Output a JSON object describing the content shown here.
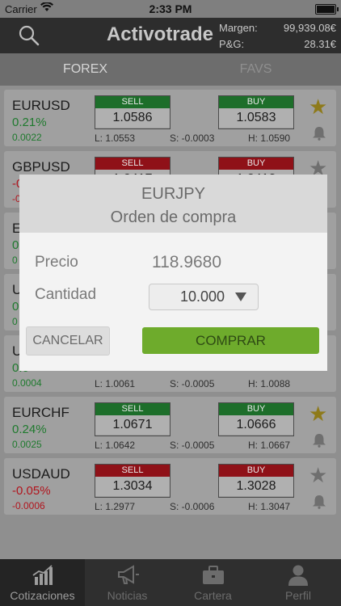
{
  "status": {
    "carrier": "Carrier",
    "time": "2:33 PM"
  },
  "header": {
    "title": "Activotrade",
    "margin_label": "Margen:",
    "margin_value": "99,939.08€",
    "pl_label": "P&G:",
    "pl_value": "28.31€"
  },
  "segments": {
    "forex": "FOREX",
    "favs": "FAVS"
  },
  "quotes": [
    {
      "symbol": "EURUSD",
      "pct": "0.21%",
      "chg": "0.0022",
      "sell_label": "SELL",
      "sell": "1.0586",
      "buy_label": "BUY",
      "buy": "1.0583",
      "low": "L: 1.0553",
      "spread": "S: -0.0003",
      "high": "H: 1.0590"
    },
    {
      "symbol": "GBPUSD",
      "pct": "-0",
      "chg": "-0",
      "sell_label": "SELL",
      "sell": "1.2417",
      "buy_label": "BUY",
      "buy": "1.2413",
      "low": "",
      "spread": "",
      "high": ""
    },
    {
      "symbol": "E",
      "pct": "0",
      "chg": "0"
    },
    {
      "symbol": "U",
      "pct": "0",
      "chg": "0"
    },
    {
      "symbol": "U",
      "pct": "0.0",
      "chg": "0.0004",
      "low": "L: 1.0061",
      "spread": "S: -0.0005",
      "high": "H: 1.0088"
    },
    {
      "symbol": "EURCHF",
      "pct": "0.24%",
      "chg": "0.0025",
      "sell_label": "SELL",
      "sell": "1.0671",
      "buy_label": "BUY",
      "buy": "1.0666",
      "low": "L: 1.0642",
      "spread": "S: -0.0005",
      "high": "H: 1.0667"
    },
    {
      "symbol": "USDAUD",
      "pct": "-0.05%",
      "chg": "-0.0006",
      "sell_label": "SELL",
      "sell": "1.3034",
      "buy_label": "BUY",
      "buy": "1.3028",
      "low": "L: 1.2977",
      "spread": "S: -0.0006",
      "high": "H: 1.3047"
    }
  ],
  "dialog": {
    "symbol": "EURJPY",
    "subtitle": "Orden de compra",
    "price_label": "Precio",
    "price_value": "118.9680",
    "qty_label": "Cantidad",
    "qty_value": "10.000",
    "cancel_label": "CANCELAR",
    "buy_label": "COMPRAR"
  },
  "tabs": {
    "quotes": "Cotizaciones",
    "news": "Noticias",
    "portfolio": "Cartera",
    "profile": "Perfil"
  },
  "colors": {
    "buy_green": "#6eab2c",
    "positive": "#1f7a2e",
    "negative": "#b1141d",
    "star": "#8e7a1a"
  }
}
